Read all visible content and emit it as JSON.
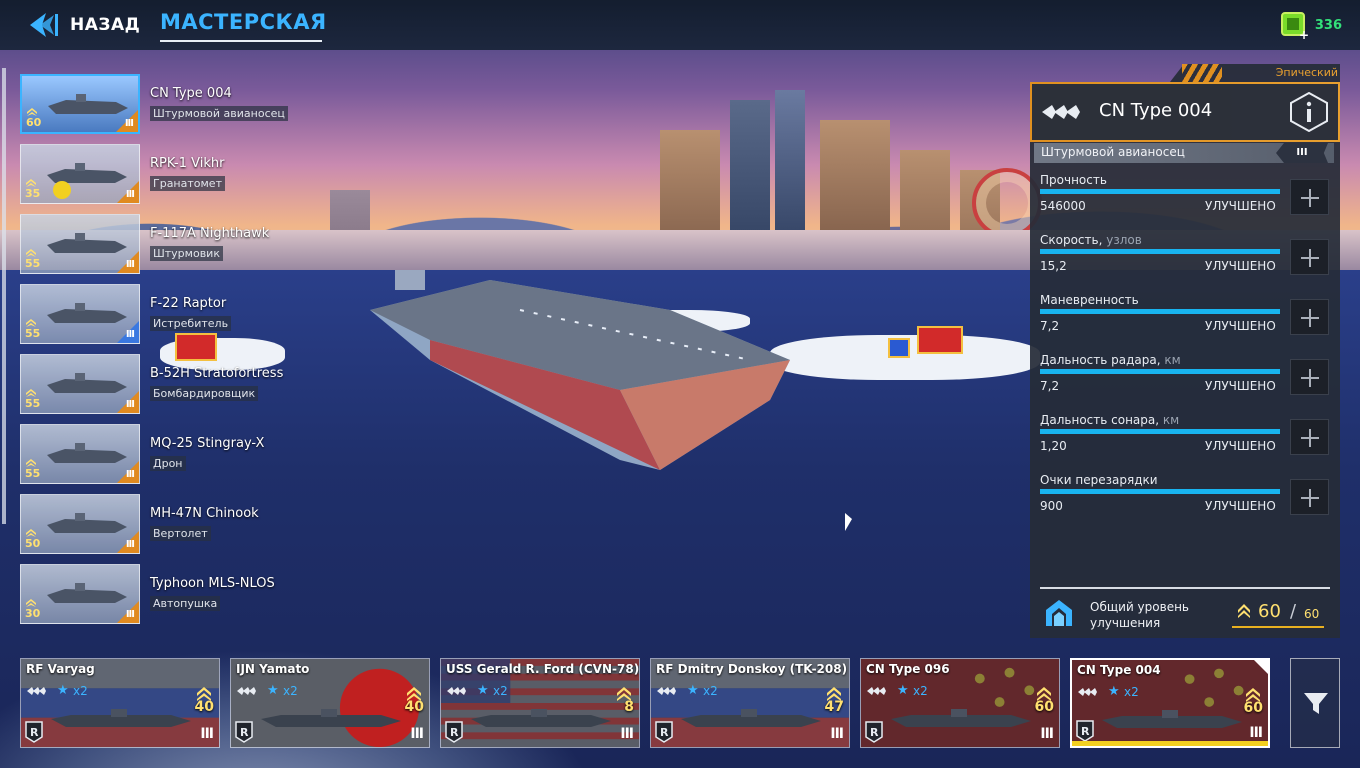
{
  "header": {
    "back_label": "НАЗАД",
    "title": "МАСТЕРСКАЯ",
    "currency_amount": "336",
    "currency_icon": "chip-icon"
  },
  "colors": {
    "accent_blue": "#3bb4ff",
    "epic_orange": "#e8a030",
    "level_yellow": "#ffe070",
    "currency_green": "#33e07a",
    "stat_bar": "#18b4f0"
  },
  "units": [
    {
      "name": "CN Type 004",
      "type": "Штурмовой авианосец",
      "level": "60",
      "tier": "III",
      "selected": true
    },
    {
      "name": "RPK-1 Vikhr",
      "type": "Гранатомет",
      "level": "35",
      "tier": "III",
      "selected": false
    },
    {
      "name": "F-117A Nighthawk",
      "type": "Штурмовик",
      "level": "55",
      "tier": "III",
      "selected": false
    },
    {
      "name": "F-22 Raptor",
      "type": "Истребитель",
      "level": "55",
      "tier": "III",
      "selected": false
    },
    {
      "name": "B-52H Stratofortress",
      "type": "Бомбардировщик",
      "level": "55",
      "tier": "III",
      "selected": false
    },
    {
      "name": "MQ-25 Stingray-X",
      "type": "Дрон",
      "level": "55",
      "tier": "III",
      "selected": false
    },
    {
      "name": "MH-47N Chinook",
      "type": "Вертолет",
      "level": "50",
      "tier": "III",
      "selected": false
    },
    {
      "name": "Typhoon MLS-NLOS",
      "type": "Автопушка",
      "level": "30",
      "tier": "III",
      "selected": false
    }
  ],
  "panel": {
    "rarity": "Эпический",
    "name": "CN Type 004",
    "class_label": "Штурмовой авианосец",
    "class_tier": "III",
    "stats": [
      {
        "label": "Прочность",
        "unit": "",
        "value": "546000",
        "status": "УЛУЧШЕНО",
        "fill": 1.0
      },
      {
        "label": "Скорость,",
        "unit": "узлов",
        "value": "15,2",
        "status": "УЛУЧШЕНО",
        "fill": 1.0
      },
      {
        "label": "Маневренность",
        "unit": "",
        "value": "7,2",
        "status": "УЛУЧШЕНО",
        "fill": 1.0
      },
      {
        "label": "Дальность радара,",
        "unit": "км",
        "value": "7,2",
        "status": "УЛУЧШЕНО",
        "fill": 1.0
      },
      {
        "label": "Дальность сонара,",
        "unit": "км",
        "value": "1,20",
        "status": "УЛУЧШЕНО",
        "fill": 1.0
      },
      {
        "label": "Очки перезарядки",
        "unit": "",
        "value": "900",
        "status": "УЛУЧШЕНО",
        "fill": 1.0
      }
    ],
    "total_label": "Общий уровень улучшения",
    "total_value": "60",
    "total_sep": "/",
    "total_max": "60"
  },
  "fleet": [
    {
      "name": "RF Varyag",
      "multiplier": "x2",
      "level": "40",
      "tier": "III",
      "flag": "russia",
      "active": false
    },
    {
      "name": "IJN Yamato",
      "multiplier": "x2",
      "level": "40",
      "tier": "III",
      "flag": "japan",
      "active": false
    },
    {
      "name": "USS Gerald R. Ford (CVN-78)",
      "multiplier": "x2",
      "level": "8",
      "tier": "III",
      "flag": "usa",
      "active": false
    },
    {
      "name": "RF Dmitry Donskoy (TK-208)",
      "multiplier": "x2",
      "level": "47",
      "tier": "III",
      "flag": "russia",
      "active": false
    },
    {
      "name": "CN Type 096",
      "multiplier": "x2",
      "level": "60",
      "tier": "III",
      "flag": "china",
      "active": false
    },
    {
      "name": "CN Type 004",
      "multiplier": "x2",
      "level": "60",
      "tier": "III",
      "flag": "china",
      "active": true
    }
  ]
}
